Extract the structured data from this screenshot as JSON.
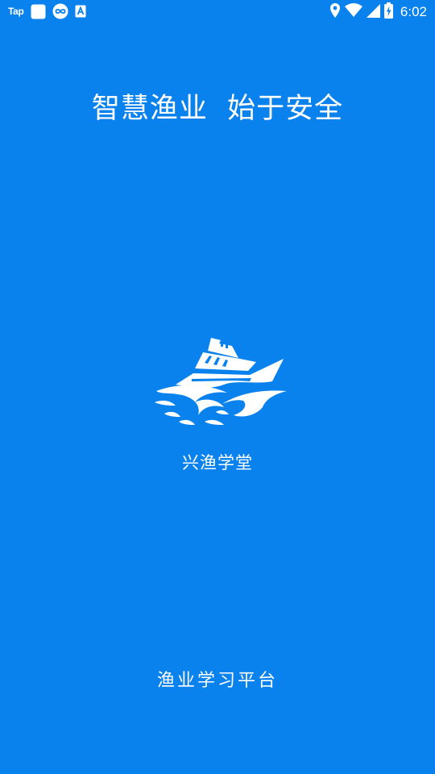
{
  "colors": {
    "background": "#0A82EE",
    "foreground": "#FFFFFF"
  },
  "status_bar": {
    "app_label": "Tap",
    "notification_icons": [
      "tap-icon",
      "white-square-icon",
      "infinity-circle-icon",
      "text-a-icon"
    ],
    "system_icons": [
      "location-icon",
      "wifi-icon",
      "signal-icon",
      "battery-charging-icon"
    ],
    "time": "6:02"
  },
  "splash": {
    "headline": "智慧渔业  始于安全",
    "logo_icon": "ship-logo-icon",
    "app_name": "兴渔学堂",
    "platform_name": "渔业学习平台"
  }
}
